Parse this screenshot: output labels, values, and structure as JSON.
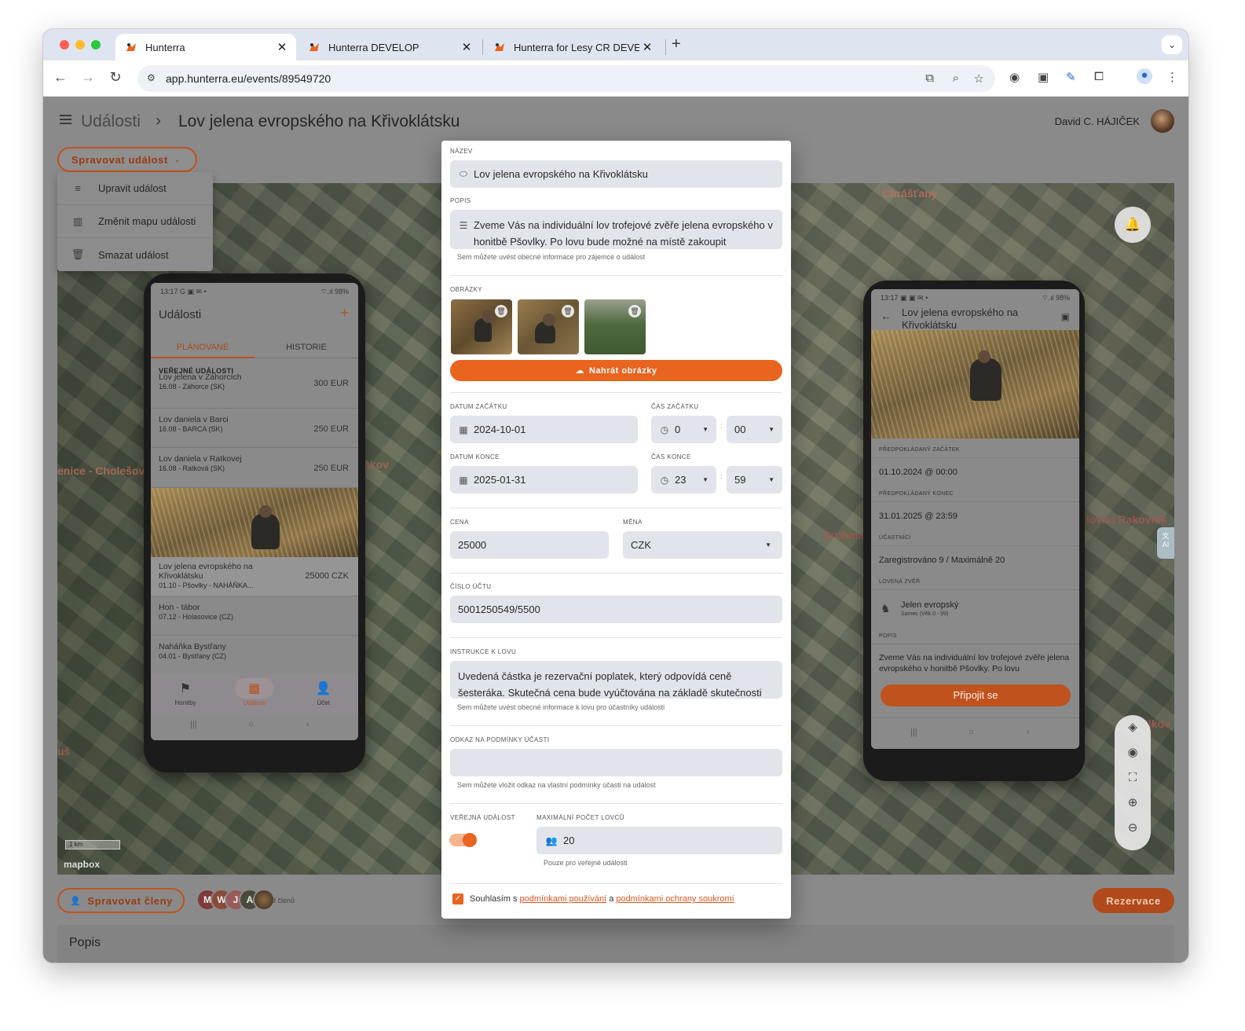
{
  "browser": {
    "tabs": [
      {
        "title": "Hunterra"
      },
      {
        "title": "Hunterra DEVELOP"
      },
      {
        "title": "Hunterra for Lesy CR DEVELOP"
      }
    ],
    "new_tab": "+",
    "url": "app.hunterra.eu/events/89549720"
  },
  "app": {
    "breadcrumb_root": "Události",
    "breadcrumb_sep": "›",
    "breadcrumb_current": "Lov jelena evropského na Křivoklátsku",
    "user_name": "David C. HÁJIČEK"
  },
  "manage_menu": {
    "button": "Spravovat událost",
    "items": [
      "Upravit událost",
      "Změnit mapu události",
      "Smazat událost"
    ]
  },
  "map": {
    "labels": [
      "Chrášťany",
      "enice - Cholešov",
      "ákov",
      "Sruhma",
      "lovna Rakovník",
      "uš",
      "ilkov"
    ],
    "scale": "1 km",
    "attribution": "mapbox",
    "ai_badge": "AI"
  },
  "left_phone": {
    "time": "13:17",
    "battery": "98%",
    "title": "Události",
    "plus": "+",
    "tabs": [
      "PLÁNOVANÉ",
      "HISTORIE"
    ],
    "section": "VEŘEJNÉ UDÁLOSTI",
    "items": [
      {
        "title": "Lov jelena v Záhorcích",
        "sub": "16.08 - Záhorce (SK)",
        "price": "300 EUR"
      },
      {
        "title": "Lov daniela v Barci",
        "sub": "16.08 - BARCA (SK)",
        "price": "250 EUR"
      },
      {
        "title": "Lov daniela v Ratkovej",
        "sub": "16.08 - Ratková (SK)",
        "price": "250 EUR"
      },
      {
        "title": "Lov jelena evropského na Křivoklátsku",
        "sub": "01.10 - Pšovlky - NAHÁŇKA...",
        "price": "25000 CZK"
      },
      {
        "title": "Hon - tábor",
        "sub": "07.12 - Holasovice (CZ)",
        "price": ""
      },
      {
        "title": "Naháňka Bystřany",
        "sub": "04.01 - Bystřany (CZ)",
        "price": ""
      }
    ],
    "nav": [
      "Honitby",
      "Události",
      "Účet"
    ]
  },
  "right_phone": {
    "time": "13:17",
    "battery": "98%",
    "title": "Lov jelena evropského na Křivoklátsku",
    "start_label": "PŘEDPOKLÁDANÝ ZAČÁTEK",
    "start_value": "01.10.2024 @ 00:00",
    "end_label": "PŘEDPOKLÁDANÝ KONEC",
    "end_value": "31.01.2025 @ 23:59",
    "participants_label": "ÚČASTNÍCI",
    "participants_value": "Zaregistrováno 9 / Maximálně 20",
    "game_label": "LOVENÁ ZVĚŘ",
    "game_name": "Jelen evropský",
    "game_sub": "Samec (Věk 0 - 99)",
    "desc_label": "POPIS",
    "desc_value": "Zveme Vás na individuální lov trofejové zvěře jelena evropského v honitbě Pšovlky. Po lovu",
    "join_button": "Připojit se"
  },
  "bottom": {
    "manage_members": "Spravovat členy",
    "member_initials": [
      "M",
      "W",
      "J",
      "A",
      ""
    ],
    "member_count": "9 členů",
    "reserve_button": "Rezervace",
    "popis_title": "Popis"
  },
  "dialog": {
    "name_label": "NÁZEV",
    "name_value": "Lov jelena evropského na Křivoklátsku",
    "desc_label": "POPIS",
    "desc_value": "Zveme Vás na individuální lov trofejové zvěře jelena evropského v honitbě Pšovlky. Po lovu bude možné na místě zakoupit",
    "desc_helper": "Sem můžete uvést obecné informace pro zájemce o událost",
    "images_label": "OBRÁZKY",
    "upload_button": "Nahrát obrázky",
    "start_date_label": "DATUM ZAČÁTKU",
    "start_date": "2024-10-01",
    "start_time_label": "ČAS ZAČÁTKU",
    "start_hour": "0",
    "start_minute": "00",
    "end_date_label": "DATUM KONCE",
    "end_date": "2025-01-31",
    "end_time_label": "ČAS KONCE",
    "end_hour": "23",
    "end_minute": "59",
    "time_sep": ":",
    "price_label": "CENA",
    "price_value": "25000",
    "currency_label": "MĚNA",
    "currency_value": "CZK",
    "account_label": "ČÍSLO ÚČTU",
    "account_value": "5001250549/5500",
    "instructions_label": "INSTRUKCE K LOVU",
    "instructions_value": "Uvedená částka je rezervační poplatek, který odpovídá ceně šesteráka. Skutečná cena bude vyúčtována na základě skutečnosti",
    "instructions_helper": "Sem můžete uvést obecné informace k lovu pro účastníky události",
    "terms_link_label": "ODKAZ NA PODMÍNKY ÚČASTI",
    "terms_link_value": "",
    "terms_link_helper": "Sem můžete vložit odkaz na vlastní podmínky účasti na událost",
    "public_label": "VEŘEJNÁ UDÁLOST",
    "public_on": true,
    "max_hunters_label": "MAXIMÁLNÍ POČET LOVCŮ",
    "max_hunters_value": "20",
    "max_hunters_helper": "Pouze pro veřejné události",
    "consent_prefix": "Souhlasím s",
    "consent_link1": "podmínkami používání",
    "consent_and": "a",
    "consent_link2": "podmínkami ochrany soukromí"
  },
  "colors": {
    "accent": "#e8641f",
    "accent_dim": "#b8521e",
    "field_bg": "#e1e4eb",
    "overlay": "#8a8a8a"
  }
}
